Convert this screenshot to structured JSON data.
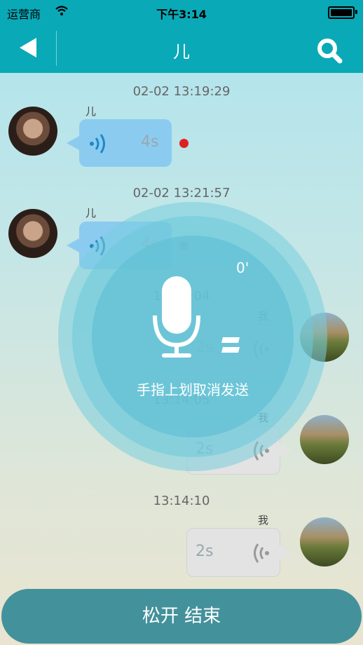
{
  "status": {
    "carrier": "运营商",
    "time": "下午3:14"
  },
  "nav": {
    "title": "儿"
  },
  "messages": [
    {
      "time": "02-02 13:19:29",
      "sender": "儿",
      "duration": "4s"
    },
    {
      "time": "02-02 13:21:57",
      "sender": "儿",
      "duration": "4s"
    },
    {
      "time": "13:14:04",
      "sender": "我",
      "duration": "2s"
    },
    {
      "time": "13:14:05",
      "sender": "我",
      "duration": "2s"
    },
    {
      "time": "13:14:10",
      "sender": "我",
      "duration": "2s"
    }
  ],
  "recording": {
    "seconds": "0'",
    "hint": "手指上划取消发送"
  },
  "bottom_button": {
    "label": "松开 结束"
  },
  "colors": {
    "header": "#0aa9b7",
    "button": "#43919b",
    "unread_dot": "#e02020"
  }
}
